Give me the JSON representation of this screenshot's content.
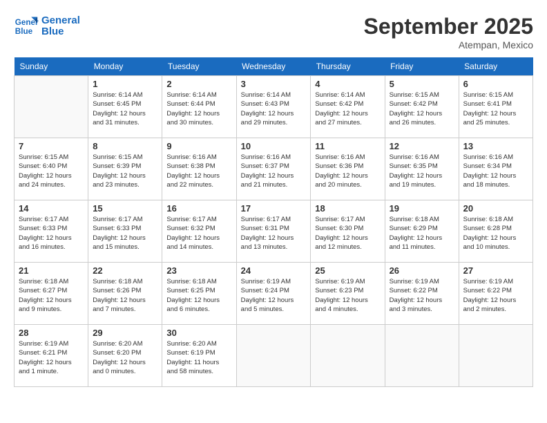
{
  "header": {
    "logo_line1": "General",
    "logo_line2": "Blue",
    "month": "September 2025",
    "location": "Atempan, Mexico"
  },
  "weekdays": [
    "Sunday",
    "Monday",
    "Tuesday",
    "Wednesday",
    "Thursday",
    "Friday",
    "Saturday"
  ],
  "weeks": [
    [
      {
        "day": "",
        "info": ""
      },
      {
        "day": "1",
        "info": "Sunrise: 6:14 AM\nSunset: 6:45 PM\nDaylight: 12 hours\nand 31 minutes."
      },
      {
        "day": "2",
        "info": "Sunrise: 6:14 AM\nSunset: 6:44 PM\nDaylight: 12 hours\nand 30 minutes."
      },
      {
        "day": "3",
        "info": "Sunrise: 6:14 AM\nSunset: 6:43 PM\nDaylight: 12 hours\nand 29 minutes."
      },
      {
        "day": "4",
        "info": "Sunrise: 6:14 AM\nSunset: 6:42 PM\nDaylight: 12 hours\nand 27 minutes."
      },
      {
        "day": "5",
        "info": "Sunrise: 6:15 AM\nSunset: 6:42 PM\nDaylight: 12 hours\nand 26 minutes."
      },
      {
        "day": "6",
        "info": "Sunrise: 6:15 AM\nSunset: 6:41 PM\nDaylight: 12 hours\nand 25 minutes."
      }
    ],
    [
      {
        "day": "7",
        "info": "Sunrise: 6:15 AM\nSunset: 6:40 PM\nDaylight: 12 hours\nand 24 minutes."
      },
      {
        "day": "8",
        "info": "Sunrise: 6:15 AM\nSunset: 6:39 PM\nDaylight: 12 hours\nand 23 minutes."
      },
      {
        "day": "9",
        "info": "Sunrise: 6:16 AM\nSunset: 6:38 PM\nDaylight: 12 hours\nand 22 minutes."
      },
      {
        "day": "10",
        "info": "Sunrise: 6:16 AM\nSunset: 6:37 PM\nDaylight: 12 hours\nand 21 minutes."
      },
      {
        "day": "11",
        "info": "Sunrise: 6:16 AM\nSunset: 6:36 PM\nDaylight: 12 hours\nand 20 minutes."
      },
      {
        "day": "12",
        "info": "Sunrise: 6:16 AM\nSunset: 6:35 PM\nDaylight: 12 hours\nand 19 minutes."
      },
      {
        "day": "13",
        "info": "Sunrise: 6:16 AM\nSunset: 6:34 PM\nDaylight: 12 hours\nand 18 minutes."
      }
    ],
    [
      {
        "day": "14",
        "info": "Sunrise: 6:17 AM\nSunset: 6:33 PM\nDaylight: 12 hours\nand 16 minutes."
      },
      {
        "day": "15",
        "info": "Sunrise: 6:17 AM\nSunset: 6:33 PM\nDaylight: 12 hours\nand 15 minutes."
      },
      {
        "day": "16",
        "info": "Sunrise: 6:17 AM\nSunset: 6:32 PM\nDaylight: 12 hours\nand 14 minutes."
      },
      {
        "day": "17",
        "info": "Sunrise: 6:17 AM\nSunset: 6:31 PM\nDaylight: 12 hours\nand 13 minutes."
      },
      {
        "day": "18",
        "info": "Sunrise: 6:17 AM\nSunset: 6:30 PM\nDaylight: 12 hours\nand 12 minutes."
      },
      {
        "day": "19",
        "info": "Sunrise: 6:18 AM\nSunset: 6:29 PM\nDaylight: 12 hours\nand 11 minutes."
      },
      {
        "day": "20",
        "info": "Sunrise: 6:18 AM\nSunset: 6:28 PM\nDaylight: 12 hours\nand 10 minutes."
      }
    ],
    [
      {
        "day": "21",
        "info": "Sunrise: 6:18 AM\nSunset: 6:27 PM\nDaylight: 12 hours\nand 9 minutes."
      },
      {
        "day": "22",
        "info": "Sunrise: 6:18 AM\nSunset: 6:26 PM\nDaylight: 12 hours\nand 7 minutes."
      },
      {
        "day": "23",
        "info": "Sunrise: 6:18 AM\nSunset: 6:25 PM\nDaylight: 12 hours\nand 6 minutes."
      },
      {
        "day": "24",
        "info": "Sunrise: 6:19 AM\nSunset: 6:24 PM\nDaylight: 12 hours\nand 5 minutes."
      },
      {
        "day": "25",
        "info": "Sunrise: 6:19 AM\nSunset: 6:23 PM\nDaylight: 12 hours\nand 4 minutes."
      },
      {
        "day": "26",
        "info": "Sunrise: 6:19 AM\nSunset: 6:22 PM\nDaylight: 12 hours\nand 3 minutes."
      },
      {
        "day": "27",
        "info": "Sunrise: 6:19 AM\nSunset: 6:22 PM\nDaylight: 12 hours\nand 2 minutes."
      }
    ],
    [
      {
        "day": "28",
        "info": "Sunrise: 6:19 AM\nSunset: 6:21 PM\nDaylight: 12 hours\nand 1 minute."
      },
      {
        "day": "29",
        "info": "Sunrise: 6:20 AM\nSunset: 6:20 PM\nDaylight: 12 hours\nand 0 minutes."
      },
      {
        "day": "30",
        "info": "Sunrise: 6:20 AM\nSunset: 6:19 PM\nDaylight: 11 hours\nand 58 minutes."
      },
      {
        "day": "",
        "info": ""
      },
      {
        "day": "",
        "info": ""
      },
      {
        "day": "",
        "info": ""
      },
      {
        "day": "",
        "info": ""
      }
    ]
  ]
}
